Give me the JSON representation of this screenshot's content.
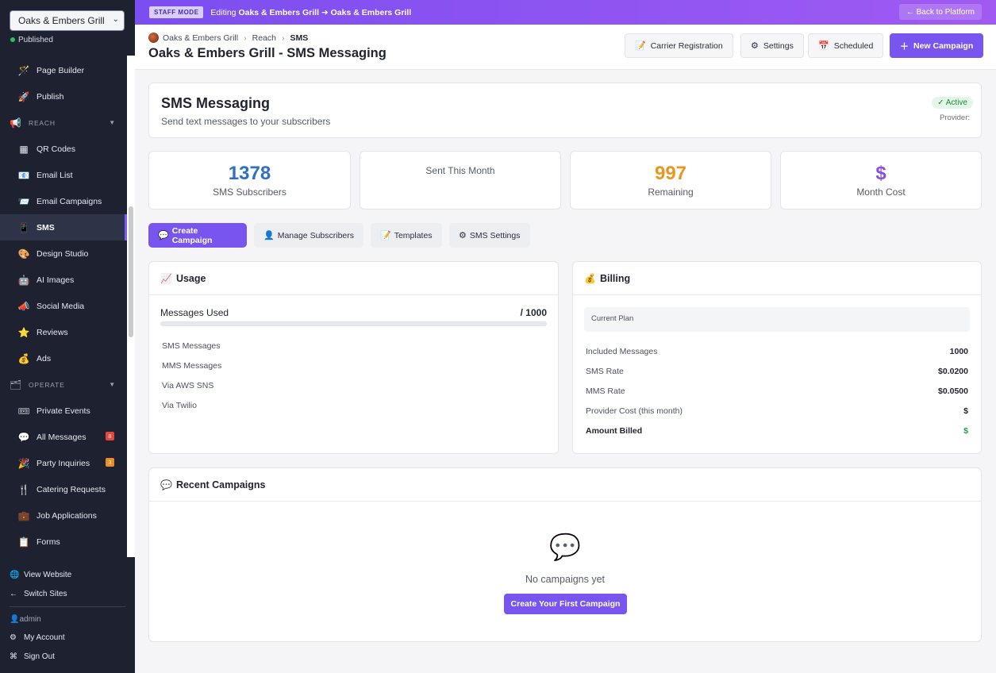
{
  "sidebar": {
    "site_select": "Oaks & Embers Grill",
    "status": "Published",
    "top_items": [
      {
        "label": "Page Builder",
        "icon": "🪄"
      },
      {
        "label": "Publish",
        "icon": "🚀"
      }
    ],
    "reach_section": "REACH",
    "reach_items": [
      {
        "label": "QR Codes",
        "icon": "▦"
      },
      {
        "label": "Email List",
        "icon": "📧"
      },
      {
        "label": "Email Campaigns",
        "icon": "📨"
      },
      {
        "label": "SMS",
        "icon": "📱"
      },
      {
        "label": "Design Studio",
        "icon": "🎨"
      },
      {
        "label": "AI Images",
        "icon": "🤖"
      },
      {
        "label": "Social Media",
        "icon": "📣"
      },
      {
        "label": "Reviews",
        "icon": "⭐"
      },
      {
        "label": "Ads",
        "icon": "💰"
      }
    ],
    "operate_section": "OPERATE",
    "operate_items": [
      {
        "label": "Private Events",
        "icon": "🎟"
      },
      {
        "label": "All Messages",
        "icon": "💬",
        "badge": "8"
      },
      {
        "label": "Party Inquiries",
        "icon": "🎉",
        "badge": "3"
      },
      {
        "label": "Catering Requests",
        "icon": "🍴"
      },
      {
        "label": "Job Applications",
        "icon": "💼"
      },
      {
        "label": "Forms",
        "icon": "📋"
      }
    ],
    "bottom": {
      "view_website": "View Website",
      "switch_sites": "Switch Sites",
      "user": "admin",
      "my_account": "My Account",
      "sign_out": "Sign Out"
    }
  },
  "staff_bar": {
    "tag": "STAFF MODE",
    "editing_prefix": "Editing",
    "site_from": "Oaks & Embers Grill",
    "arrow": "➜",
    "site_to": "Oaks & Embers Grill",
    "back_label": "← Back to Platform"
  },
  "header": {
    "breadcrumb": [
      "Oaks & Embers Grill",
      "Reach",
      "SMS"
    ],
    "title": "Oaks & Embers Grill - SMS Messaging",
    "buttons": {
      "carrier": "Carrier Registration",
      "settings": "Settings",
      "scheduled": "Scheduled",
      "new_campaign": "New Campaign"
    }
  },
  "intro": {
    "title": "SMS Messaging",
    "subtitle": "Send text messages to your subscribers",
    "status": "✓ Active",
    "provider": "Provider:"
  },
  "stats": [
    {
      "value": "1378",
      "label": "SMS Subscribers",
      "color": "#2f6fc4"
    },
    {
      "value": "",
      "label": "Sent This Month",
      "color": "#1f2430"
    },
    {
      "value": "997",
      "label": "Remaining",
      "color": "#e8961e"
    },
    {
      "value": "$",
      "label": "Month Cost",
      "color": "#8a4fd8"
    }
  ],
  "tabs": {
    "create": "Create Campaign",
    "manage": "Manage Subscribers",
    "templates": "Templates",
    "settings": "SMS Settings"
  },
  "usage": {
    "title": "Usage",
    "messages_used_label": "Messages Used",
    "messages_used_value": "/ 1000",
    "progress": 0,
    "lines": [
      "SMS Messages",
      "MMS Messages",
      "Via AWS SNS",
      "Via Twilio"
    ]
  },
  "billing": {
    "title": "Billing",
    "current_plan": "Current Plan",
    "rows": [
      {
        "label": "Included Messages",
        "value": "1000"
      },
      {
        "label": "SMS Rate",
        "value": "$0.0200"
      },
      {
        "label": "MMS Rate",
        "value": "$0.0500"
      },
      {
        "label": "Provider Cost (this month)",
        "value": "$"
      },
      {
        "label": "Amount Billed",
        "value": "$"
      }
    ]
  },
  "campaigns": {
    "title": "Recent Campaigns",
    "empty_text": "No campaigns yet",
    "empty_button": "Create Your First Campaign"
  },
  "colors": {
    "accent": "#7755ee",
    "sidebar_bg": "#1e2230",
    "success": "#1f9a4a"
  }
}
